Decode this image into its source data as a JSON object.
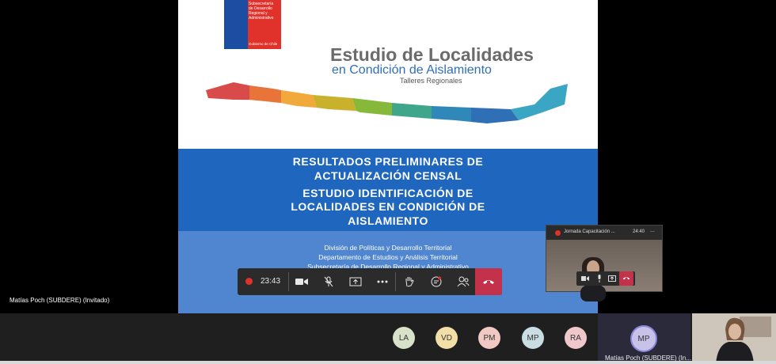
{
  "slide": {
    "agency_lines": [
      "Subsecretaría",
      "de Desarrollo",
      "Regional y",
      "Administrativo"
    ],
    "gov_label": "Gobierno de Chile",
    "title": "Estudio de Localidades",
    "subtitle": "en Condición de Aislamiento",
    "subtitle2": "Talleres Regionales",
    "band_lines": [
      "RESULTADOS PRELIMINARES DE",
      "ACTUALIZACIÓN CENSAL",
      "ESTUDIO IDENTIFICACIÓN DE",
      "LOCALIDADES EN CONDICIÓN DE",
      "AISLAMIENTO"
    ],
    "footer_lines": [
      "División de Políticas y Desarrollo Territorial",
      "Departamento de Estudios y Análisis Territorial",
      "Subsecretaría de Desarrollo Regional y Administrativo"
    ]
  },
  "toolbar": {
    "timer": "23:43",
    "buttons": [
      "camera-icon",
      "mic-off-icon",
      "share-icon",
      "more-icon",
      "raise-hand-icon",
      "chat-icon",
      "participants-icon",
      "hangup-icon"
    ]
  },
  "presenter_name": "Matías Poch (SUBDERE) (Invitado)",
  "mini_window": {
    "title": "Jornada Capacitación ...",
    "time": "24:40",
    "more": "..."
  },
  "participants": [
    "LA",
    "VD",
    "PM",
    "MP",
    "RA"
  ],
  "active_tile": {
    "initials": "MP",
    "name": "Matías Poch (SUBDERE) (In..."
  },
  "colors": {
    "slide_blue": "#1f66bf",
    "slide_foot": "#4f86cf",
    "hangup": "#c4314b"
  }
}
